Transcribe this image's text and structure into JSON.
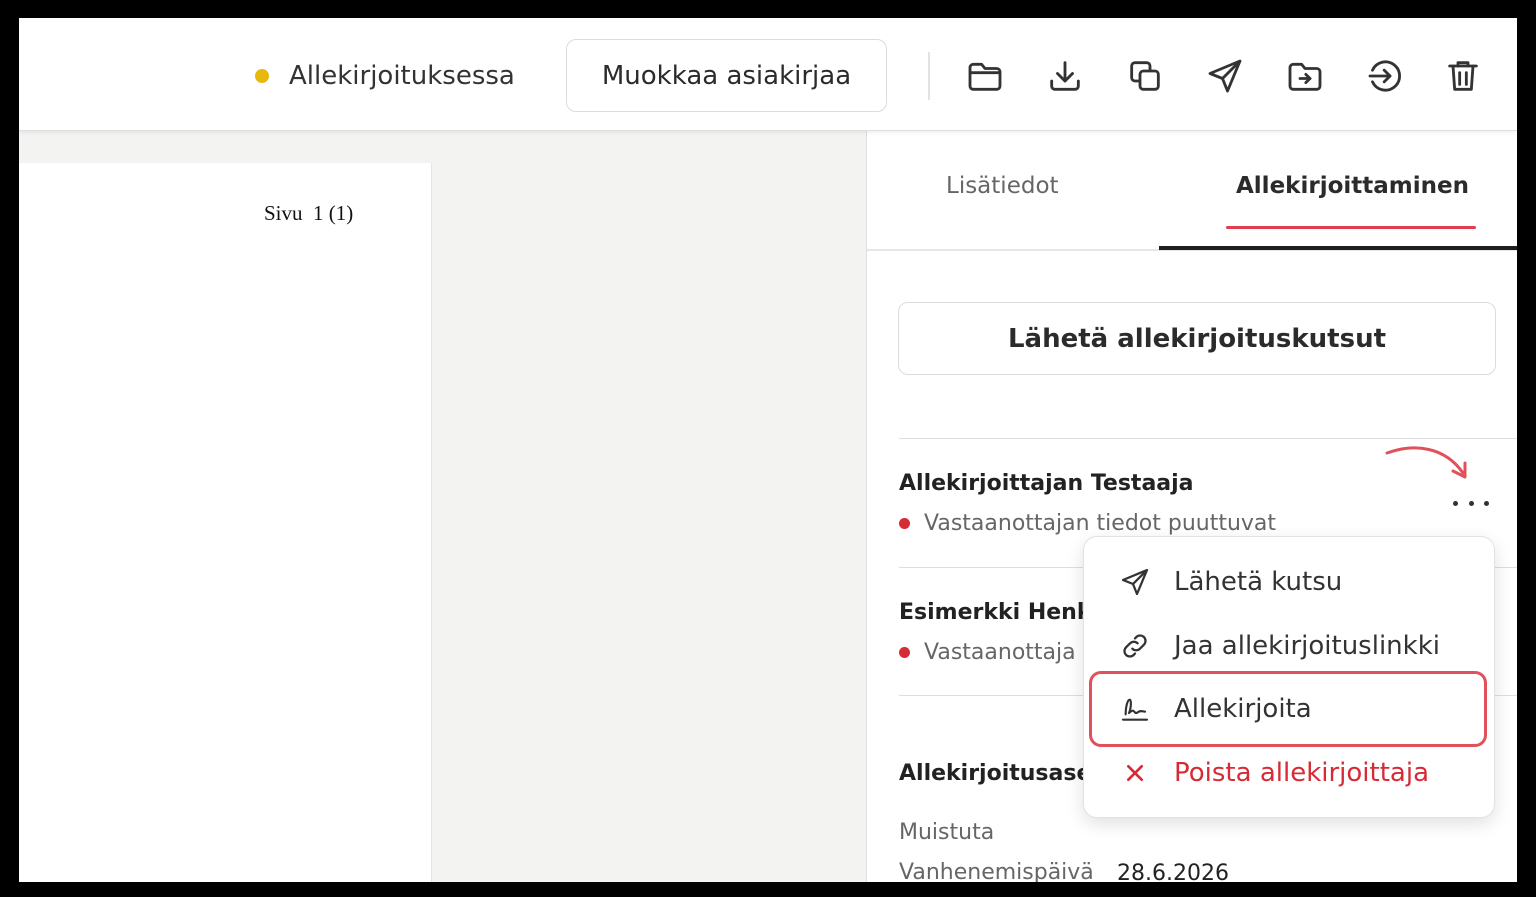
{
  "header": {
    "status_label": "Allekirjoituksessa",
    "status_color": "#e8b90c",
    "edit_button": "Muokkaa asiakirjaa",
    "icons": [
      "folder-icon",
      "download-icon",
      "copy-icon",
      "send-icon",
      "move-to-folder-icon",
      "sign-in-icon",
      "trash-icon"
    ]
  },
  "document": {
    "page_number": "Sivu  1 (1)"
  },
  "panel": {
    "tabs": [
      {
        "label": "Lisätiedot",
        "active": false
      },
      {
        "label": "Allekirjoittaminen",
        "active": true
      }
    ],
    "send_invitations_button": "Lähetä allekirjoituskutsut",
    "signers": [
      {
        "name": "Allekirjoittajan Testaaja",
        "status": "Vastaanottajan tiedot puuttuvat"
      },
      {
        "name": "Esimerkki Henk",
        "status": "Vastaanottaja"
      }
    ],
    "settings": {
      "title": "Allekirjoitusase",
      "remind_label": "Muistuta",
      "expiry_label": "Vanhenemispäivä",
      "expiry_value": "28.6.2026"
    }
  },
  "menu": {
    "items": [
      {
        "label": "Lähetä kutsu",
        "icon": "send-icon"
      },
      {
        "label": "Jaa allekirjoituslinkki",
        "icon": "link-icon"
      },
      {
        "label": "Allekirjoita",
        "icon": "signature-icon",
        "highlighted": true
      },
      {
        "label": "Poista allekirjoittaja",
        "icon": "close-icon",
        "danger": true
      }
    ]
  },
  "colors": {
    "accent_red": "#e03e4c",
    "status_red": "#d62b36"
  }
}
